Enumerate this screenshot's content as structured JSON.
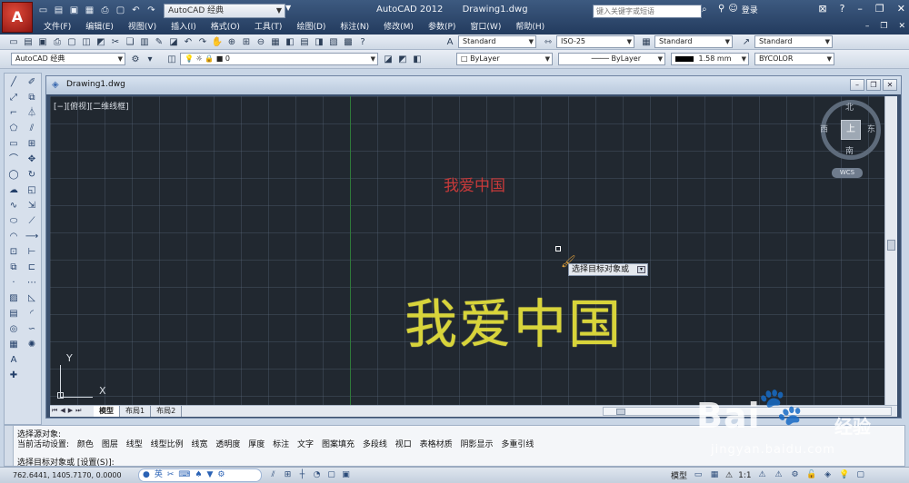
{
  "app": {
    "workspace": "AutoCAD 经典",
    "title_app": "AutoCAD 2012",
    "title_doc": "Drawing1.dwg",
    "search_placeholder": "键入关键字或短语",
    "login": "登录"
  },
  "menu": [
    "文件(F)",
    "编辑(E)",
    "视图(V)",
    "插入(I)",
    "格式(O)",
    "工具(T)",
    "绘图(D)",
    "标注(N)",
    "修改(M)",
    "参数(P)",
    "窗口(W)",
    "帮助(H)"
  ],
  "toolbar": {
    "text_style": "Standard",
    "dim_style": "ISO-25",
    "table_style": "Standard",
    "mleader_style": "Standard",
    "workspace2": "AutoCAD 经典",
    "layer": "0",
    "color": "ByLayer",
    "linetype": "ByLayer",
    "lineweight": "1.58 mm",
    "plotstyle": "BYCOLOR"
  },
  "drawing": {
    "doc_name": "Drawing1.dwg",
    "view_label": "[−][俯视][二维线框]",
    "text_small": "我爱中国",
    "text_large": "我爱中国",
    "tooltip": "选择目标对象或",
    "viewcube": {
      "north": "北",
      "south": "南",
      "east": "东",
      "west": "西",
      "face": "上"
    },
    "wcs": "WCS",
    "ucs": {
      "x": "X",
      "y": "Y"
    },
    "tabs": [
      "模型",
      "布局1",
      "布局2"
    ],
    "colors": {
      "small_text": "#c83a3a",
      "large_text": "#d8d43a",
      "canvas": "#212830"
    }
  },
  "command": {
    "line1": "选择源对象:",
    "line2_prefix": "当前活动设置:",
    "line2_items": [
      "颜色",
      "图层",
      "线型",
      "线型比例",
      "线宽",
      "透明度",
      "厚度",
      "标注",
      "文字",
      "图案填充",
      "多段线",
      "视口",
      "表格材质",
      "阴影显示",
      "多重引线"
    ],
    "line3": "选择目标对象或 [设置(S)]:"
  },
  "status": {
    "coords": "762.6441,  1405.7170, 0.0000",
    "ime": "英",
    "model": "模型",
    "scale": "1:1"
  },
  "watermark": {
    "logo": "Bai",
    "logo2": "经验",
    "url": "jingyan.baidu.com"
  }
}
